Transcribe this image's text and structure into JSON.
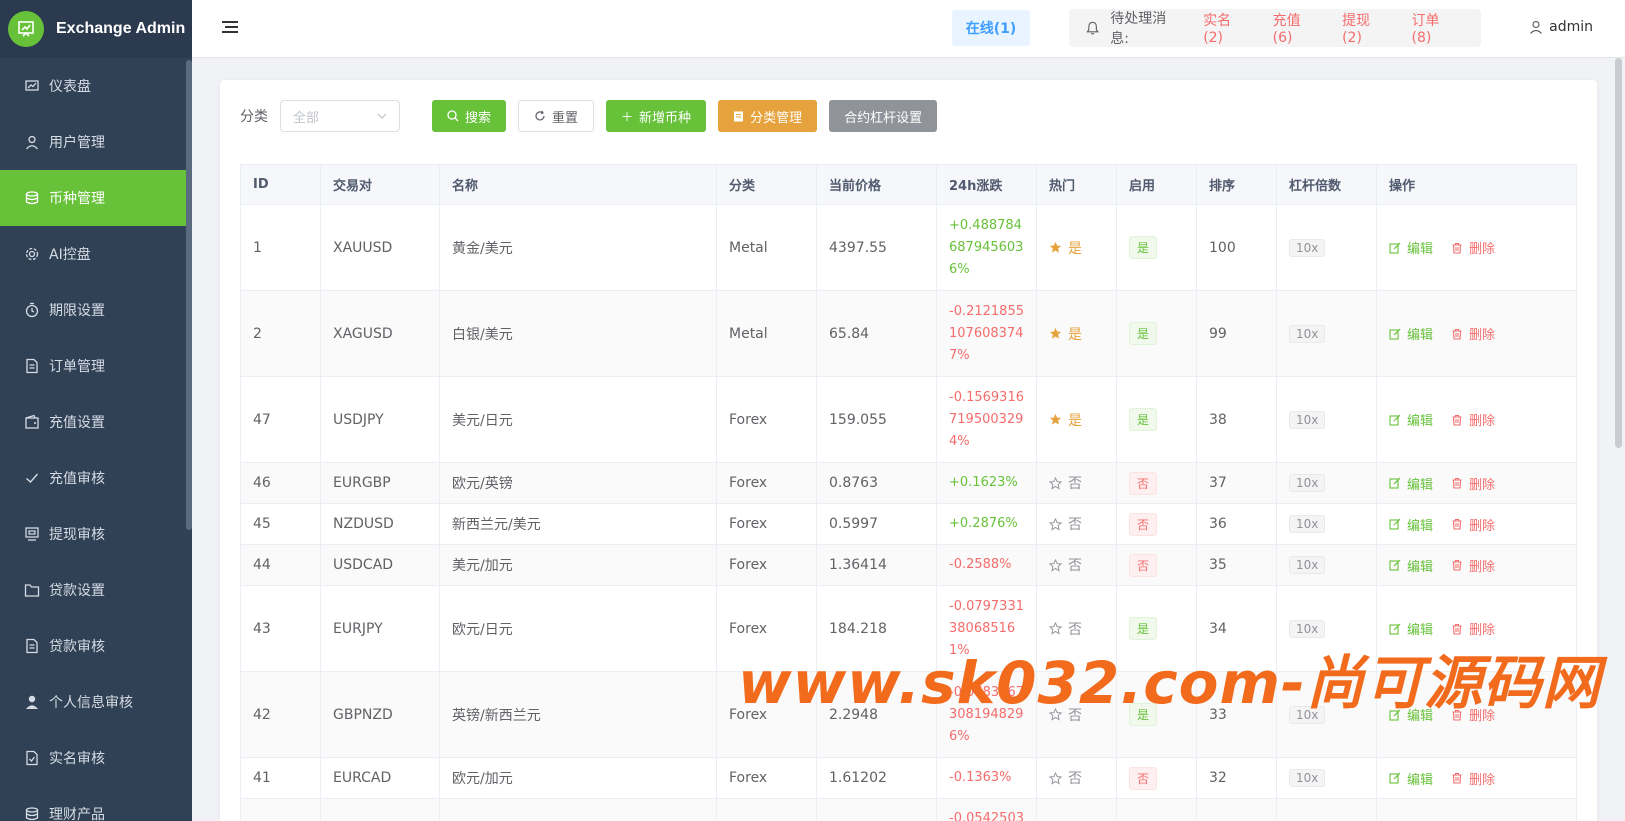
{
  "app": {
    "title": "Exchange Admin"
  },
  "sidebar": {
    "items": [
      {
        "label": "仪表盘",
        "icon": "dashboard-icon"
      },
      {
        "label": "用户管理",
        "icon": "user-icon"
      },
      {
        "label": "币种管理",
        "icon": "database-icon",
        "active": true
      },
      {
        "label": "AI控盘",
        "icon": "gear-icon"
      },
      {
        "label": "期限设置",
        "icon": "timer-icon"
      },
      {
        "label": "订单管理",
        "icon": "document-icon"
      },
      {
        "label": "充值设置",
        "icon": "wallet-icon"
      },
      {
        "label": "充值审核",
        "icon": "check-icon"
      },
      {
        "label": "提现审核",
        "icon": "withdraw-icon"
      },
      {
        "label": "贷款设置",
        "icon": "folder-icon"
      },
      {
        "label": "贷款审核",
        "icon": "document-icon"
      },
      {
        "label": "个人信息审核",
        "icon": "person-icon"
      },
      {
        "label": "实名审核",
        "icon": "file-check-icon"
      },
      {
        "label": "理财产品",
        "icon": "database-icon"
      }
    ]
  },
  "header": {
    "online": "在线(1)",
    "pending_label": "待处理消息:",
    "pending": [
      "实名(2)",
      "充值(6)",
      "提现(2)",
      "订单(8)"
    ],
    "user": "admin"
  },
  "toolbar": {
    "category_label": "分类",
    "category_placeholder": "全部",
    "search": "搜索",
    "reset": "重置",
    "add": "新增币种",
    "category_manage": "分类管理",
    "leverage": "合约杠杆设置"
  },
  "table": {
    "headers": [
      "ID",
      "交易对",
      "名称",
      "分类",
      "当前价格",
      "24h涨跌",
      "热门",
      "启用",
      "排序",
      "杠杆倍数",
      "操作"
    ],
    "edit_label": "编辑",
    "delete_label": "删除",
    "rows": [
      {
        "id": "1",
        "pair": "XAUUSD",
        "name": "黄金/美元",
        "cat": "Metal",
        "price": "4397.55",
        "change": "+0.4887846879456036%",
        "dir": "up",
        "hot": "是",
        "hot_on": true,
        "enabled": "是",
        "en_on": true,
        "sort": "100",
        "lev": "10x"
      },
      {
        "id": "2",
        "pair": "XAGUSD",
        "name": "白银/美元",
        "cat": "Metal",
        "price": "65.84",
        "change": "-0.2121855107608374 7%",
        "dir": "down",
        "hot": "是",
        "hot_on": true,
        "enabled": "是",
        "en_on": true,
        "sort": "99",
        "lev": "10x"
      },
      {
        "id": "47",
        "pair": "USDJPY",
        "name": "美元/日元",
        "cat": "Forex",
        "price": "159.055",
        "change": "-0.15693167195003294%",
        "dir": "down",
        "hot": "是",
        "hot_on": true,
        "enabled": "是",
        "en_on": true,
        "sort": "38",
        "lev": "10x"
      },
      {
        "id": "46",
        "pair": "EURGBP",
        "name": "欧元/英镑",
        "cat": "Forex",
        "price": "0.8763",
        "change": "+0.1623%",
        "dir": "up",
        "hot": "否",
        "hot_on": false,
        "enabled": "否",
        "en_on": false,
        "sort": "37",
        "lev": "10x"
      },
      {
        "id": "45",
        "pair": "NZDUSD",
        "name": "新西兰元/美元",
        "cat": "Forex",
        "price": "0.5997",
        "change": "+0.2876%",
        "dir": "up",
        "hot": "否",
        "hot_on": false,
        "enabled": "否",
        "en_on": false,
        "sort": "36",
        "lev": "10x"
      },
      {
        "id": "44",
        "pair": "USDCAD",
        "name": "美元/加元",
        "cat": "Forex",
        "price": "1.36414",
        "change": "-0.2588%",
        "dir": "down",
        "hot": "否",
        "hot_on": false,
        "enabled": "否",
        "en_on": false,
        "sort": "35",
        "lev": "10x"
      },
      {
        "id": "43",
        "pair": "EURJPY",
        "name": "欧元/日元",
        "cat": "Forex",
        "price": "184.218",
        "change": "-0.0797331380685161%",
        "dir": "down",
        "hot": "否",
        "hot_on": false,
        "enabled": "是",
        "en_on": true,
        "sort": "34",
        "lev": "10x"
      },
      {
        "id": "42",
        "pair": "GBPNZD",
        "name": "英镑/新西兰元",
        "cat": "Forex",
        "price": "2.2948",
        "change": "-0.07837673081948296%",
        "dir": "down",
        "hot": "否",
        "hot_on": false,
        "enabled": "是",
        "en_on": true,
        "sort": "33",
        "lev": "10x"
      },
      {
        "id": "41",
        "pair": "EURCAD",
        "name": "欧元/加元",
        "cat": "Forex",
        "price": "1.61202",
        "change": "-0.1363%",
        "dir": "down",
        "hot": "否",
        "hot_on": false,
        "enabled": "否",
        "en_on": false,
        "sort": "32",
        "lev": "10x"
      },
      {
        "id": "",
        "pair": "",
        "name": "",
        "cat": "",
        "price": "",
        "change": "-0.0542503",
        "dir": "down",
        "hot": "",
        "hot_on": false,
        "enabled": "",
        "en_on": false,
        "sort": "",
        "lev": ""
      }
    ]
  },
  "watermark": "www.sk032.com-尚可源码网",
  "colors": {
    "sidebar": "#304156",
    "accent": "#67c23a",
    "danger": "#f56c6c",
    "warning": "#e6a23c"
  }
}
